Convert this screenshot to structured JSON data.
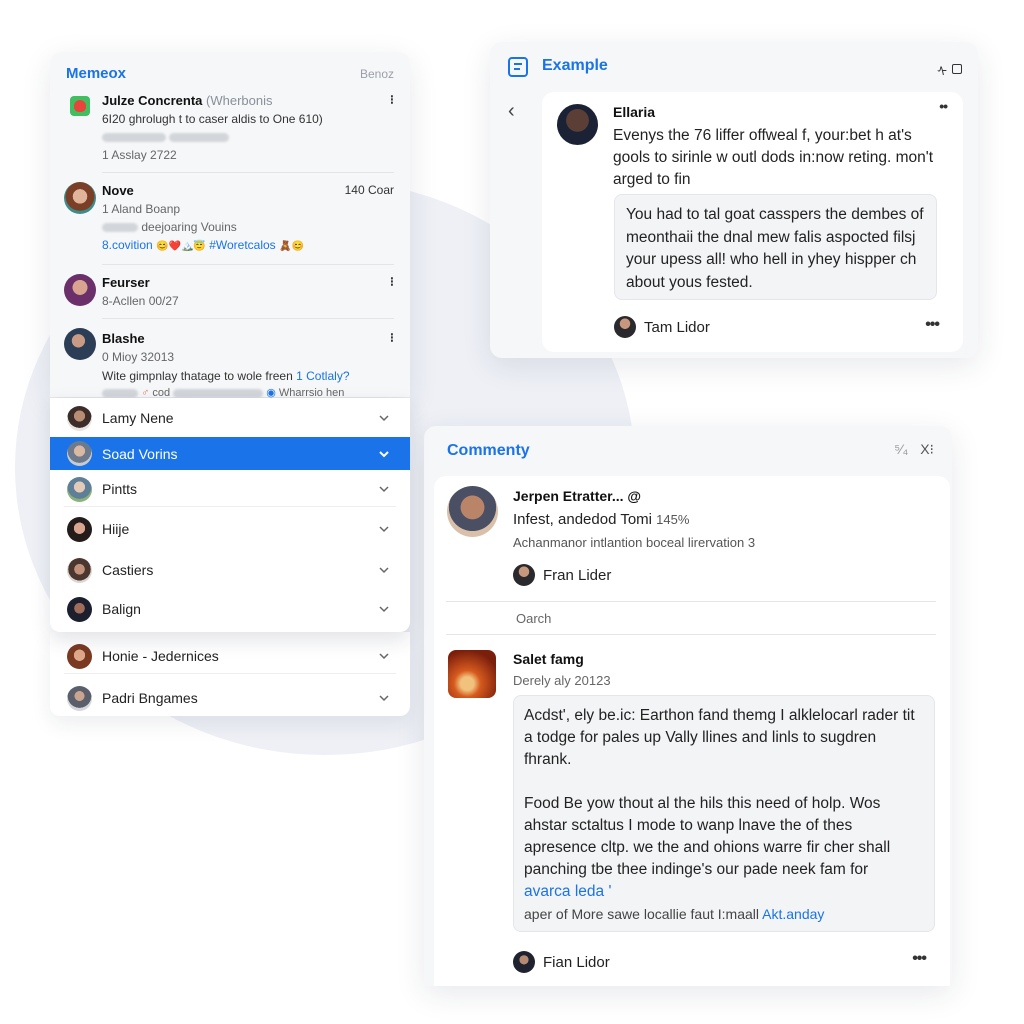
{
  "colors": {
    "accent": "#1a73e8",
    "panel_bg": "#f6f7f9",
    "selected_row": "#1a73e8"
  },
  "left_panel": {
    "title": "Memeox",
    "action": "Benoz",
    "messages": [
      {
        "name": "Julze Concrenta",
        "name_suffix": "(Wherbonis",
        "line1": "6I20 ghrolugh t to caser aldis to One 610)",
        "line3": "1 Asslay 2722",
        "icon": "heart-app-icon",
        "menu_icon": "kebab-icon"
      },
      {
        "name": "Nove",
        "time": "140 Coar",
        "line1": "1 Aland Boanp",
        "line2": "deejoaring Vouins",
        "link": "8.covition",
        "emojis": "😊❤️🏔️😇",
        "hashtag": "#Woretcalos",
        "emojis2": "🧸😊"
      },
      {
        "name": "Feurser",
        "line1": "8-Acllen 00/27",
        "menu_icon": "kebab-icon"
      },
      {
        "name": "Blashe",
        "line1": "0 Mioy 32013",
        "line2": "Wite gimpnlay thatage to wole freen",
        "link": "1 Cotlaly?",
        "line3_a": "cod",
        "line3_b": "Wharrsio hen",
        "menu_icon": "kebab-icon"
      }
    ]
  },
  "contacts": {
    "items": [
      {
        "name": "Lamy Nene",
        "selected": false
      },
      {
        "name": "Soad Vorins",
        "selected": true
      },
      {
        "name": "Pintts",
        "selected": false
      },
      {
        "name": "Hiije",
        "selected": false
      },
      {
        "name": "Castiers",
        "selected": false
      },
      {
        "name": "Balign",
        "selected": false
      },
      {
        "name": "Honie - Jedernices",
        "selected": false
      },
      {
        "name": "Padri Bngames",
        "selected": false
      }
    ]
  },
  "example_panel": {
    "title": "Example",
    "ctrl_glyph": "ᠰ",
    "post": {
      "author": "Ellaria",
      "body": "Evenys the 76 liffer offweal f, your:bet h at's gools to sirinle w outl dods in:now reting. mon't arged to fin",
      "quote": "You had to tal goat casspers the dembes of meonthaii the dnal mew falis aspocted filsj your upess all! who hell in yhey hispper ch about yous fested.",
      "footer_author": "Tam Lidor"
    }
  },
  "comment_panel": {
    "title": "Commenty",
    "ctrl1": "⁵⁄₄",
    "ctrl2": "X⁝",
    "first": {
      "name": "Jerpen Etratter... @",
      "line2": "Infest, andedod Tomi",
      "line2_pct": "145%",
      "line3": "Achanmanor intlantion boceal lirervation 3",
      "author": "Fran Lider"
    },
    "search_label": "Oarch",
    "second": {
      "name": "Salet famg",
      "date": "Derely aly 20123",
      "para1": "Acdst', ely be.ic: Earthon fand themg I alklelocarl rader tit a todge for pales up Vally llines and linls to sugdren fhrank.",
      "para2": "Food Be yow thout al the hils this need of holp. Wos ahstar sctaltus I mode to wanp lnave the of thes apresence cltp. we the and ohions warre fir cher shall panching tbe thee indinge's our pade neek fam for",
      "link": "avarca leda '",
      "foot": "aper of More sawe locallie faut I:maall",
      "foot_link": "Akt.anday",
      "author": "Fian Lidor"
    }
  }
}
